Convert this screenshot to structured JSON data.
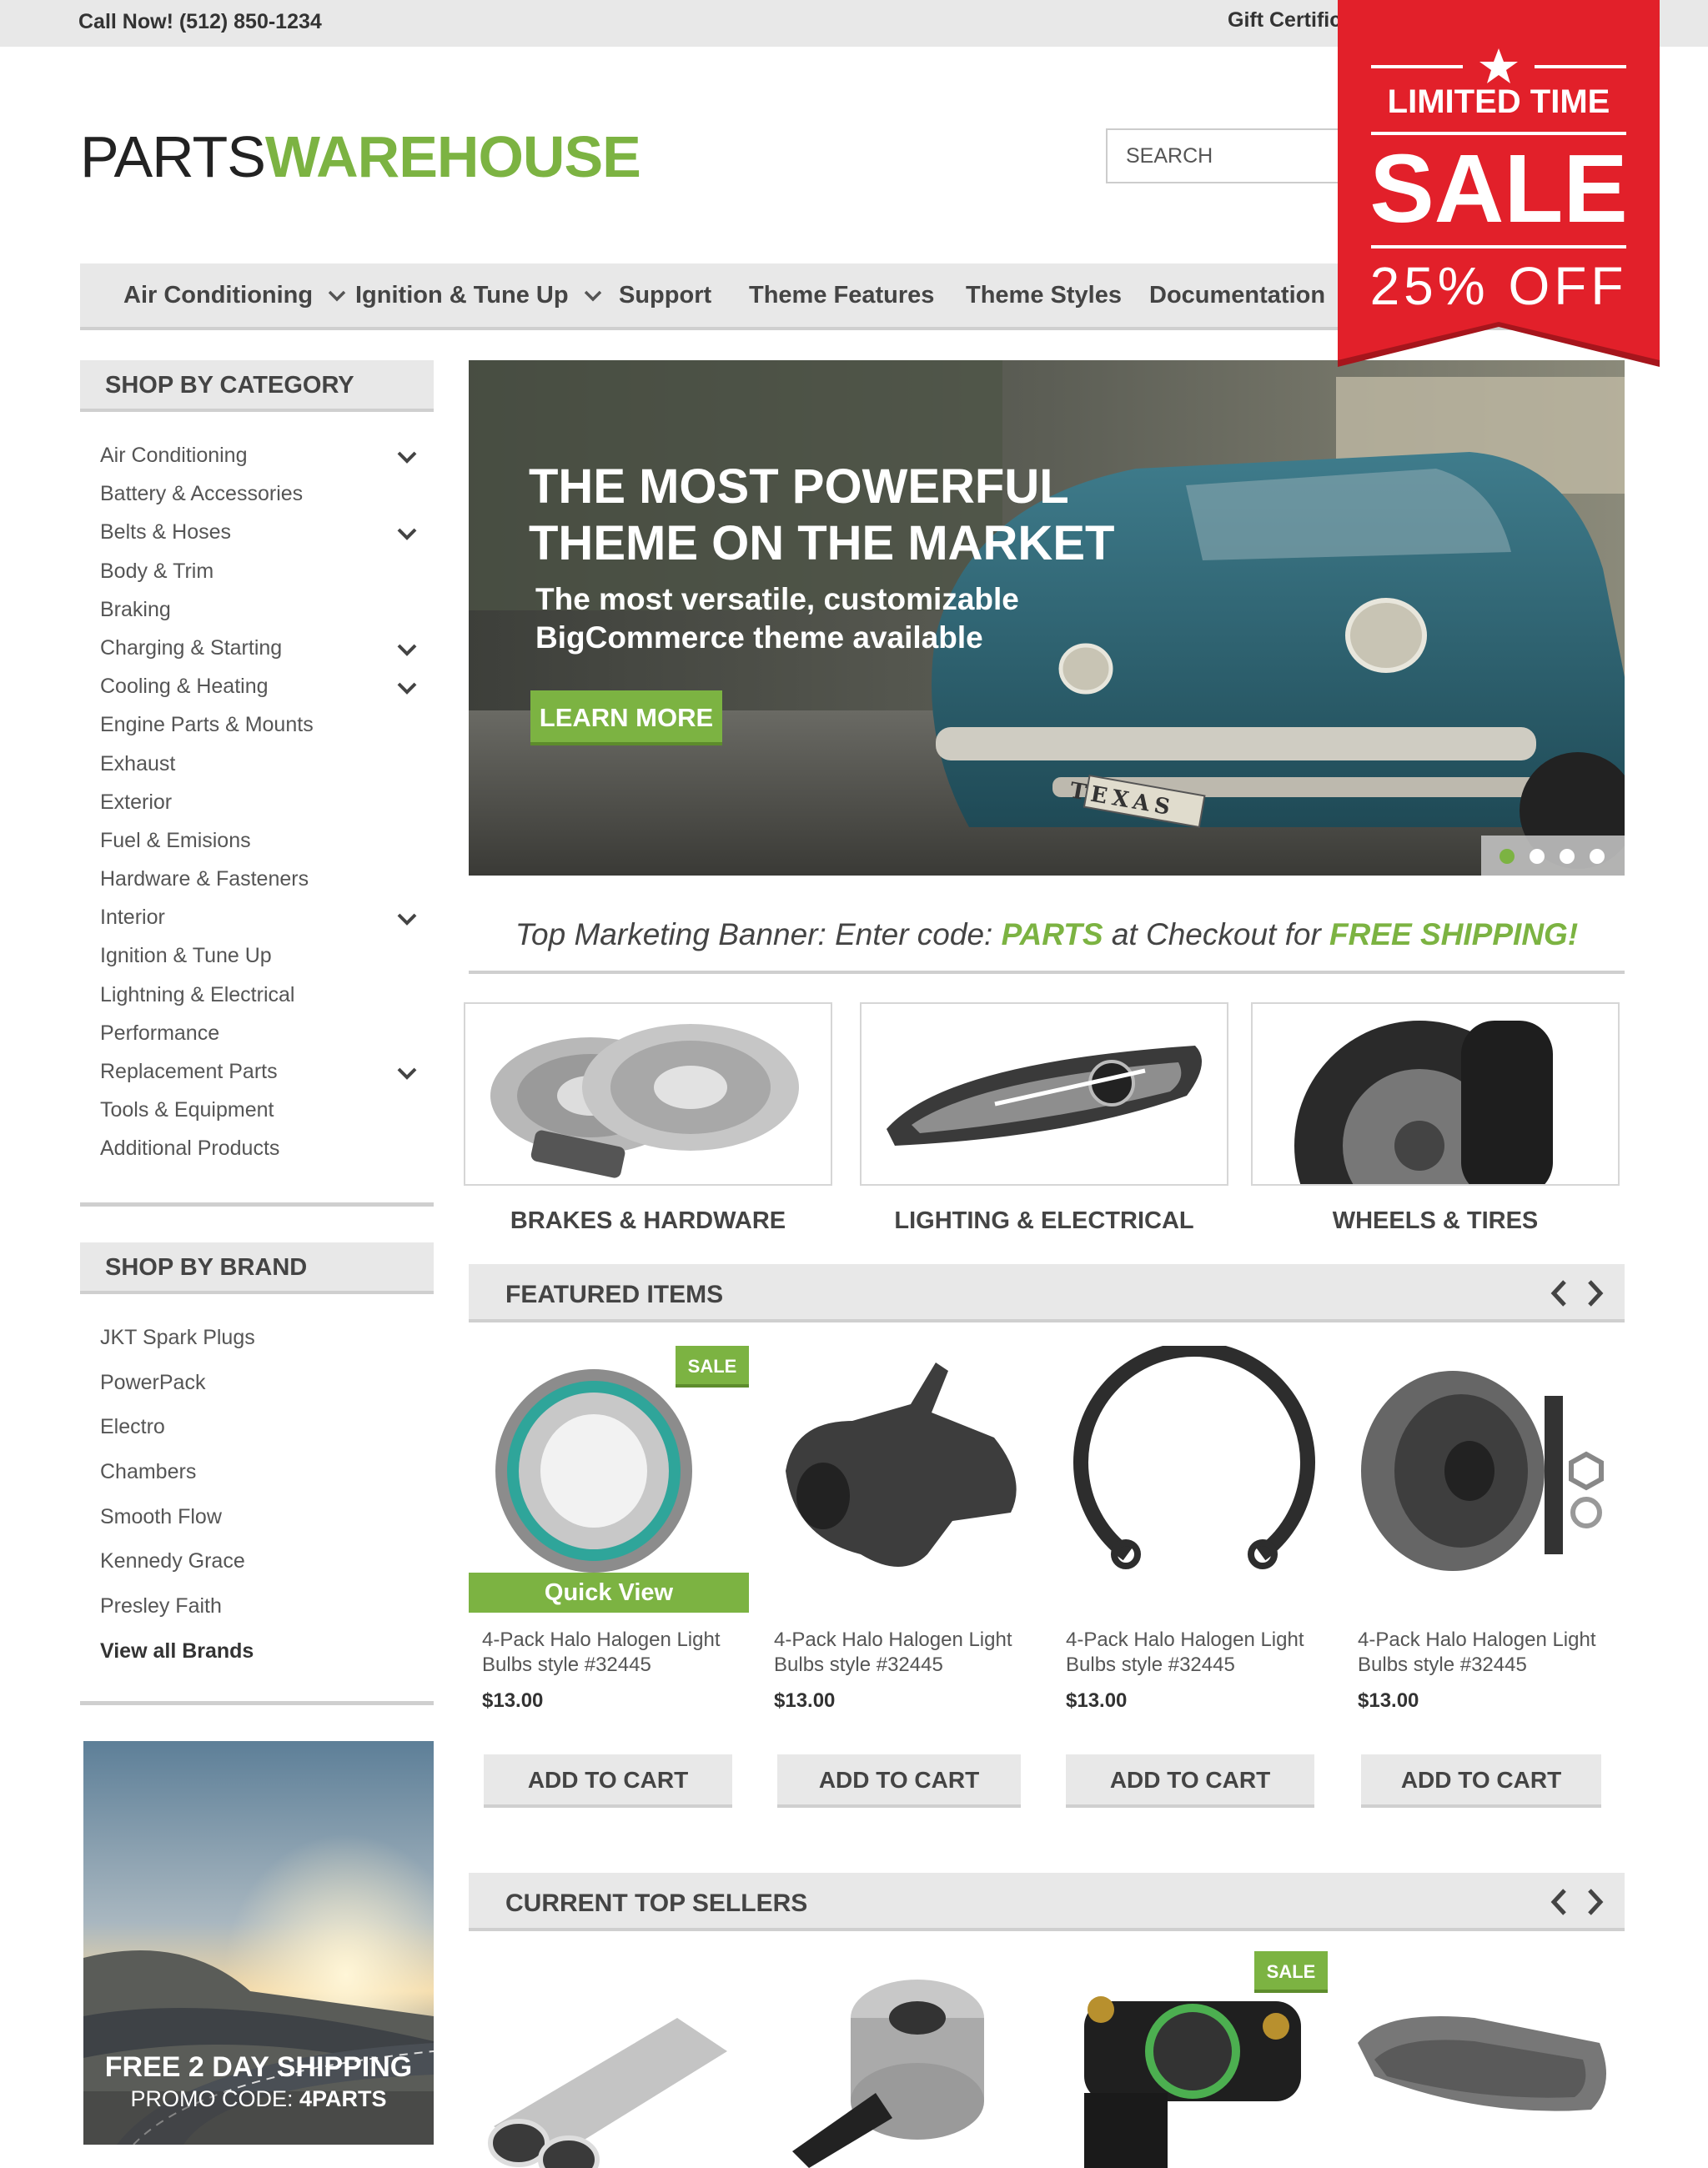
{
  "topbar": {
    "phone": "Call Now! (512) 850-1234",
    "gift": "Gift Certifica"
  },
  "logo": {
    "part1": "PARTS",
    "part2": "WAREHOUSE"
  },
  "search": {
    "placeholder": "SEARCH"
  },
  "nav": [
    {
      "label": "Air Conditioning",
      "dropdown": true
    },
    {
      "label": "Ignition & Tune Up",
      "dropdown": true
    },
    {
      "label": "Support",
      "dropdown": false
    },
    {
      "label": "Theme Features",
      "dropdown": false
    },
    {
      "label": "Theme Styles",
      "dropdown": false
    },
    {
      "label": "Documentation",
      "dropdown": false
    }
  ],
  "sale_badge": {
    "line1": "LIMITED TIME",
    "line2": "SALE",
    "line3": "25% OFF",
    "color": "#e2202a"
  },
  "sidebar": {
    "category_heading": "SHOP BY CATEGORY",
    "categories": [
      {
        "label": "Air Conditioning",
        "expand": true
      },
      {
        "label": "Battery & Accessories",
        "expand": false
      },
      {
        "label": "Belts & Hoses",
        "expand": true
      },
      {
        "label": "Body & Trim",
        "expand": false
      },
      {
        "label": "Braking",
        "expand": false
      },
      {
        "label": "Charging & Starting",
        "expand": true
      },
      {
        "label": "Cooling & Heating",
        "expand": true
      },
      {
        "label": "Engine Parts & Mounts",
        "expand": false
      },
      {
        "label": "Exhaust",
        "expand": false
      },
      {
        "label": "Exterior",
        "expand": false
      },
      {
        "label": "Fuel & Emisions",
        "expand": false
      },
      {
        "label": "Hardware & Fasteners",
        "expand": false
      },
      {
        "label": "Interior",
        "expand": true
      },
      {
        "label": "Ignition & Tune Up",
        "expand": false
      },
      {
        "label": "Lightning & Electrical",
        "expand": false
      },
      {
        "label": "Performance",
        "expand": false
      },
      {
        "label": "Replacement Parts",
        "expand": true
      },
      {
        "label": "Tools & Equipment",
        "expand": false
      },
      {
        "label": "Additional Products",
        "expand": false
      }
    ],
    "brand_heading": "SHOP BY BRAND",
    "brands": [
      "JKT Spark Plugs",
      "PowerPack",
      "Electro",
      "Chambers",
      "Smooth Flow",
      "Kennedy Grace",
      "Presley Faith"
    ],
    "view_all": "View all Brands",
    "promo": {
      "line1": "FREE 2 DAY SHIPPING",
      "line2_prefix": "PROMO CODE: ",
      "line2_code": "4PARTS"
    }
  },
  "hero": {
    "headline_1": "THE MOST POWERFUL",
    "headline_2": "THEME ON THE MARKET",
    "sub_1": "The most versatile, customizable",
    "sub_2": "BigCommerce theme available",
    "button": "LEARN MORE",
    "plate": "TEXAS",
    "slides": 4,
    "active_slide": 1
  },
  "marketing": {
    "p1": "Top Marketing Banner: Enter code: ",
    "code": "PARTS",
    "p2": " at Checkout for ",
    "offer": "FREE SHIPPING!"
  },
  "categories_row": [
    {
      "label": "BRAKES & HARDWARE"
    },
    {
      "label": "LIGHTING & ELECTRICAL"
    },
    {
      "label": "WHEELS & TIRES"
    }
  ],
  "featured": {
    "heading": "FEATURED ITEMS",
    "sale_label": "SALE",
    "quick_view": "Quick View",
    "items": [
      {
        "title": "4-Pack Halo Halogen Light Bulbs style #32445",
        "price": "$13.00",
        "cart": "ADD TO CART",
        "sale": true
      },
      {
        "title": "4-Pack Halo Halogen Light Bulbs style #32445",
        "price": "$13.00",
        "cart": "ADD TO CART",
        "sale": false
      },
      {
        "title": "4-Pack Halo Halogen Light Bulbs style #32445",
        "price": "$13.00",
        "cart": "ADD TO CART",
        "sale": false
      },
      {
        "title": "4-Pack Halo Halogen Light Bulbs style #32445",
        "price": "$13.00",
        "cart": "ADD TO CART",
        "sale": false
      }
    ]
  },
  "top_sellers": {
    "heading": "CURRENT TOP SELLERS",
    "sale_label": "SALE"
  },
  "colors": {
    "accent": "#7cb342",
    "panel": "#e8e8e8",
    "rule": "#cfcfcf",
    "red": "#e2202a"
  }
}
